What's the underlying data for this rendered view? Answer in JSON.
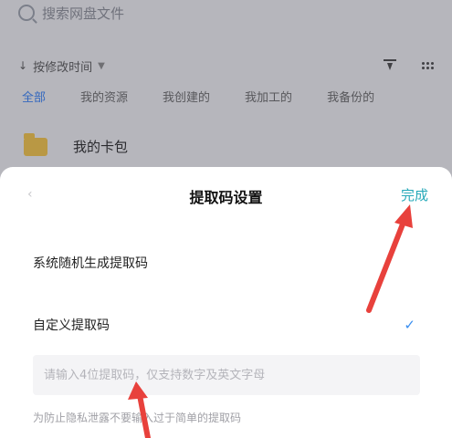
{
  "background": {
    "search_placeholder": "搜索网盘文件",
    "sort_label": "按修改时间",
    "tabs": [
      "全部",
      "我的资源",
      "我创建的",
      "我加工的",
      "我备份的"
    ],
    "folder_name": "我的卡包"
  },
  "sheet": {
    "title": "提取码设置",
    "done_label": "完成",
    "option_random": "系统随机生成提取码",
    "option_custom": "自定义提取码",
    "input_placeholder": "请输入4位提取码，仅支持数字及英文字母",
    "input_value": "",
    "hint": "为防止隐私泄露不要输入过于简单的提取码"
  },
  "colors": {
    "accent": "#27a9b9",
    "check": "#3a8ff0",
    "arrow": "#e8413c",
    "tab_active": "#2f7df6"
  }
}
